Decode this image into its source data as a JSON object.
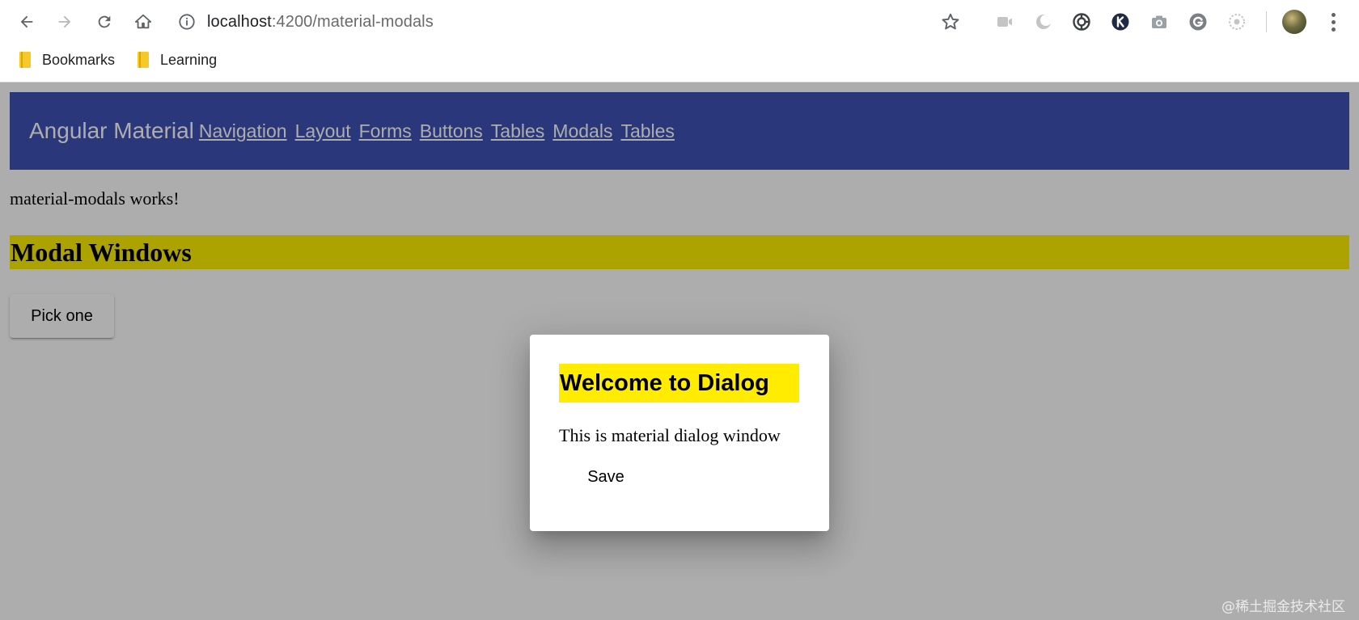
{
  "browser": {
    "url_host": "localhost",
    "url_path": ":4200/material-modals",
    "bookmarks": [
      {
        "label": "Bookmarks"
      },
      {
        "label": "Learning"
      }
    ]
  },
  "page": {
    "brand": "Angular Material",
    "nav_links": [
      "Navigation",
      "Layout",
      "Forms",
      "Buttons",
      "Tables",
      "Modals",
      "Tables"
    ],
    "works_text": "material-modals works!",
    "section_title": "Modal Windows",
    "pick_button": "Pick one"
  },
  "dialog": {
    "title": "Welcome to Dialog",
    "content": "This is material dialog window",
    "save_label": "Save"
  },
  "watermark": "@稀土掘金技术社区",
  "colors": {
    "navbar": "#3f51b5",
    "section_highlight": "#fff000",
    "dialog_title_highlight": "#ffec00",
    "backdrop": "rgba(0,0,0,0.32)"
  }
}
